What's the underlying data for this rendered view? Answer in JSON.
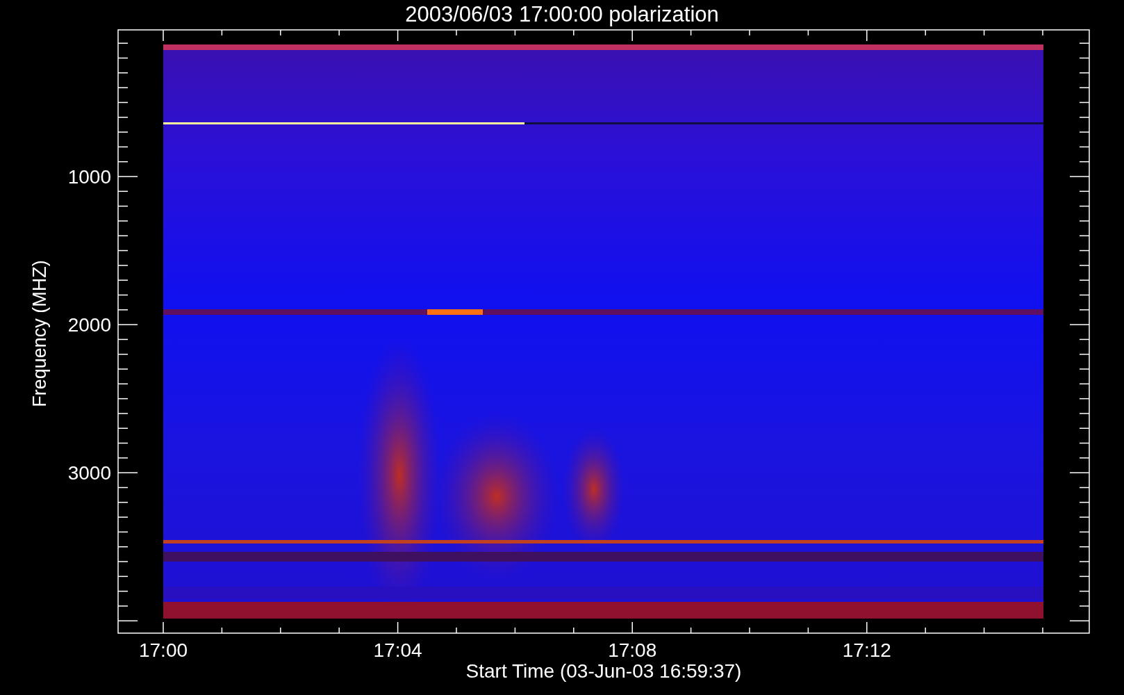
{
  "title": "2003/06/03 17:00:00 polarization",
  "x_axis": {
    "label": "Start Time (03-Jun-03 16:59:37)",
    "ticks": [
      "17:00",
      "17:04",
      "17:08",
      "17:12"
    ]
  },
  "y_axis": {
    "label": "Frequency (MHZ)",
    "ticks": [
      "1000",
      "2000",
      "3000"
    ]
  }
}
